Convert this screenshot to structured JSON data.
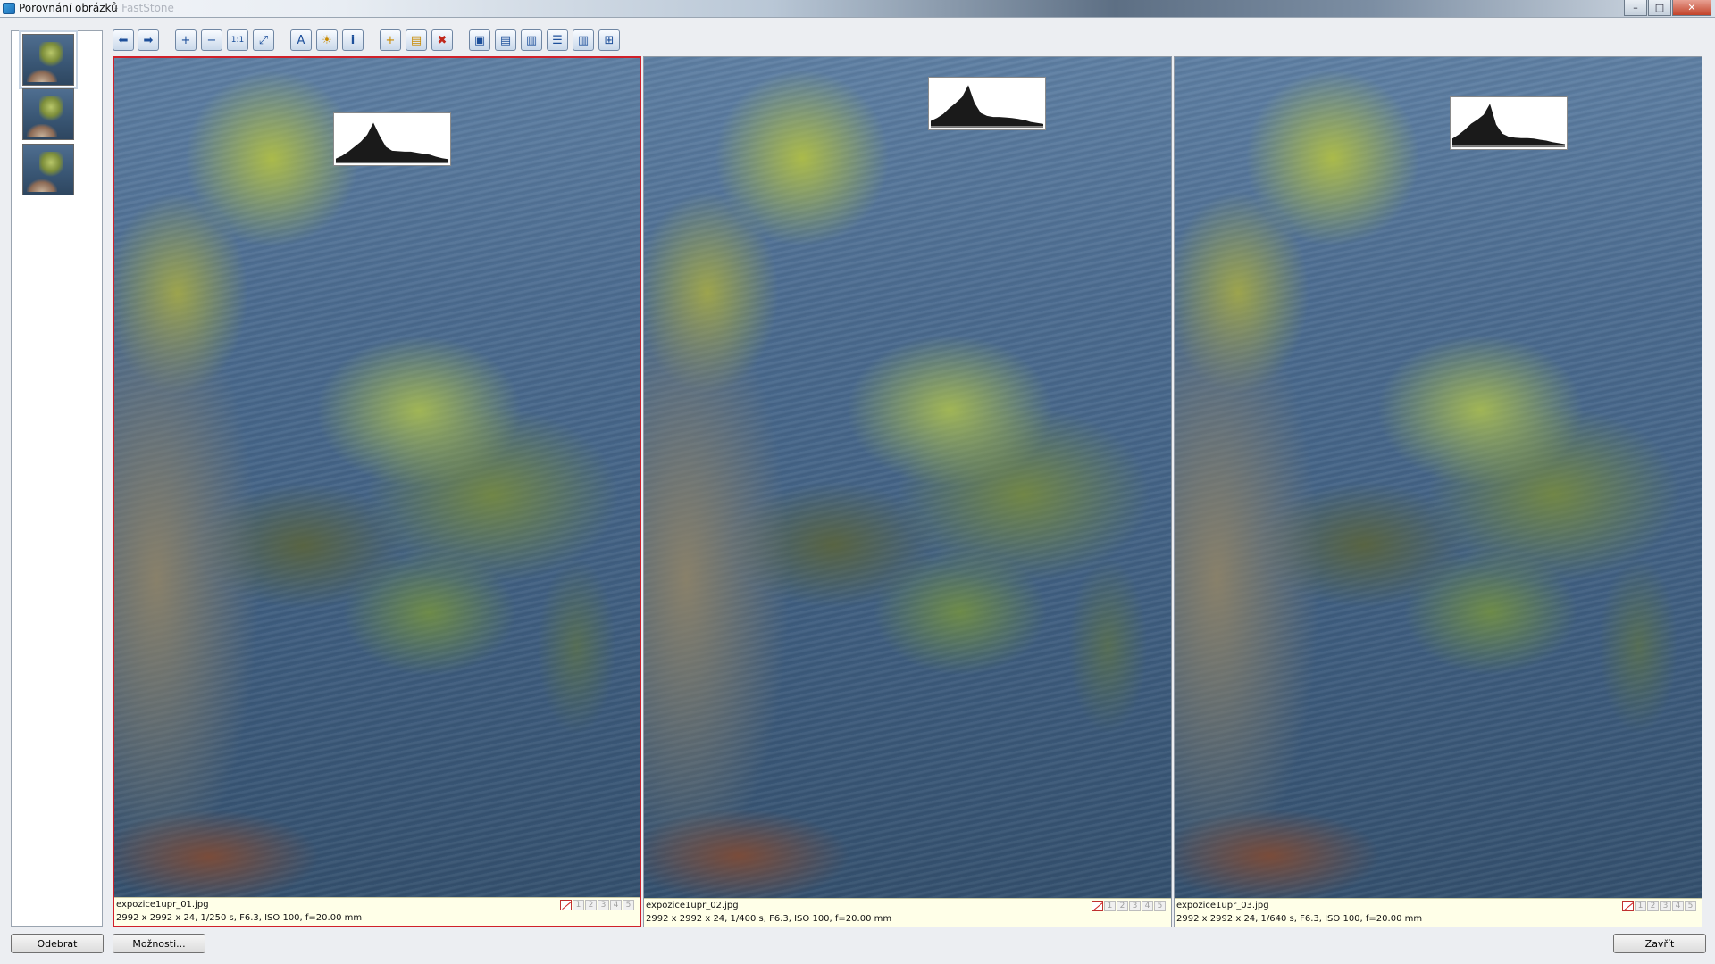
{
  "window": {
    "title": "Porovnání obrázků",
    "title_ghost": "- FastStone"
  },
  "window_buttons": {
    "minimize": "–",
    "maximize": "□",
    "close": "✕"
  },
  "toolbar": {
    "back": "⬅",
    "forward": "➡",
    "zoom_in": "+",
    "zoom_out": "−",
    "actual_size": "1:1",
    "fit": "⤢",
    "rename": "A",
    "highlight": "☀",
    "info": "i",
    "add": "+",
    "open": "▤",
    "delete": "✖",
    "layout_1": "▣",
    "layout_2": "▤",
    "layout_3": "▥",
    "layout_4": "☰",
    "layout_5": "▥",
    "layout_6": "⊞"
  },
  "panes": [
    {
      "filename": "expozice1upr_01.jpg",
      "meta": "2992 x 2992 x 24, 1/250 s, F6.3, ISO 100, f=20.00 mm",
      "active": true,
      "histogram": [
        6,
        12,
        20,
        30,
        40,
        54,
        78,
        52,
        30,
        22,
        21,
        20,
        20,
        18,
        16,
        14,
        10,
        7,
        5
      ]
    },
    {
      "filename": "expozice1upr_02.jpg",
      "meta": "2992 x 2992 x 24, 1/400 s, F6.3, ISO 100, f=20.00 mm",
      "active": false,
      "histogram": [
        10,
        16,
        24,
        36,
        46,
        58,
        82,
        46,
        26,
        20,
        18,
        18,
        17,
        16,
        14,
        12,
        8,
        6,
        4
      ]
    },
    {
      "filename": "expozice1upr_03.jpg",
      "meta": "2992 x 2992 x 24, 1/640 s, F6.3, ISO 100, f=20.00 mm",
      "active": false,
      "histogram": [
        14,
        22,
        32,
        44,
        52,
        62,
        84,
        42,
        24,
        18,
        16,
        15,
        15,
        14,
        12,
        10,
        7,
        5,
        3
      ]
    }
  ],
  "ratings": [
    "1",
    "2",
    "3",
    "4",
    "5"
  ],
  "bottom": {
    "remove": "Odebrat",
    "options": "Možnosti...",
    "close": "Zavřít"
  },
  "colors": {
    "active_border": "#d0202a",
    "info_background": "#ffffe8",
    "toolbar_icon": "#1d4f9a"
  }
}
